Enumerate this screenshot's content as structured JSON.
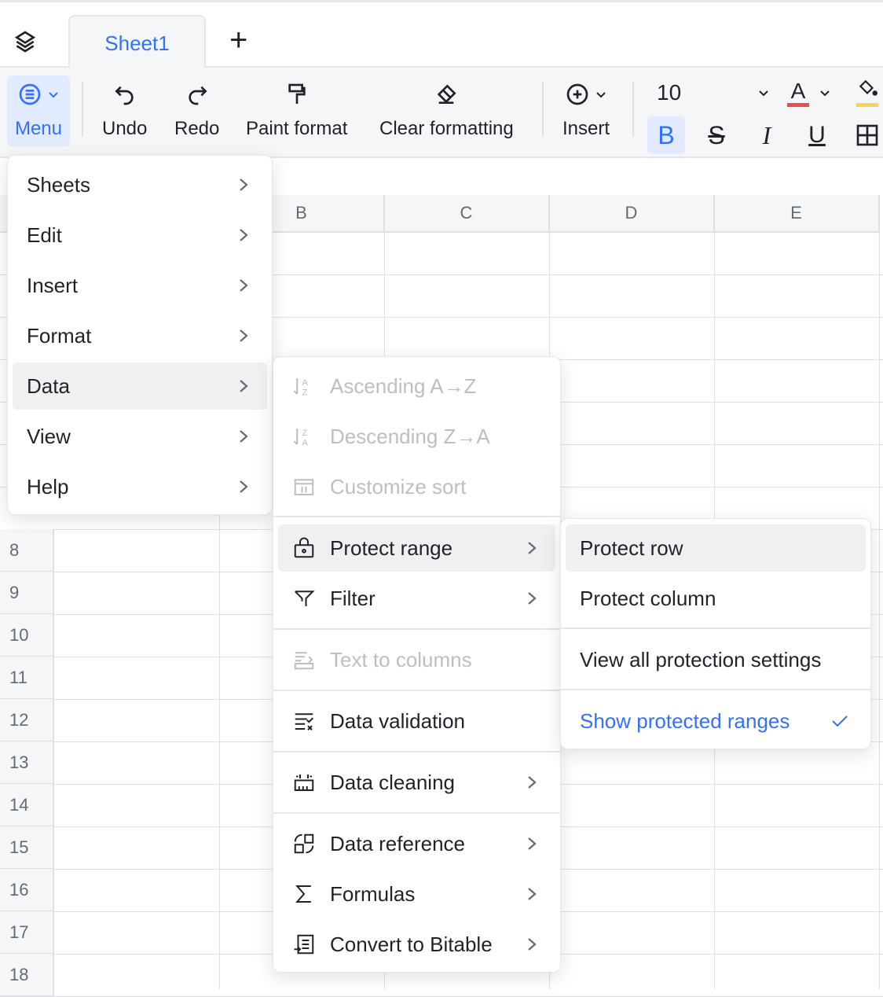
{
  "tabs": {
    "sheets": [
      "Sheet1"
    ],
    "active": "Sheet1",
    "add_label": "+"
  },
  "toolbar": {
    "menu": "Menu",
    "undo": "Undo",
    "redo": "Redo",
    "paint_format": "Paint format",
    "clear_formatting": "Clear formatting",
    "insert": "Insert",
    "font_size": "10",
    "bold": "B",
    "strike": "S",
    "italic": "I",
    "underline": "U",
    "text_color": "A",
    "accent": "#3370ff",
    "text_color_swatch": "#f54a45",
    "fill_color_swatch": "#fad355"
  },
  "columns": [
    "B",
    "C",
    "D",
    "E"
  ],
  "rows": [
    "8",
    "9",
    "10",
    "11",
    "12",
    "13",
    "14",
    "15",
    "16",
    "17",
    "18"
  ],
  "main_menu": {
    "items": [
      {
        "label": "Sheets"
      },
      {
        "label": "Edit"
      },
      {
        "label": "Insert"
      },
      {
        "label": "Format"
      },
      {
        "label": "Data",
        "highlighted": true
      },
      {
        "label": "View"
      },
      {
        "label": "Help"
      }
    ]
  },
  "data_menu": {
    "items": [
      {
        "label": "Ascending A→Z",
        "icon": "sort-ascending-icon",
        "disabled": true
      },
      {
        "label": "Descending Z→A",
        "icon": "sort-descending-icon",
        "disabled": true
      },
      {
        "label": "Customize sort",
        "icon": "customize-sort-icon",
        "disabled": true
      },
      {
        "label": "Protect range",
        "icon": "lock-icon",
        "submenu": true,
        "highlighted": true
      },
      {
        "label": "Filter",
        "icon": "filter-icon",
        "submenu": true
      },
      {
        "label": "Text to columns",
        "icon": "text-to-columns-icon",
        "disabled": true
      },
      {
        "label": "Data validation",
        "icon": "data-validation-icon"
      },
      {
        "label": "Data cleaning",
        "icon": "data-cleaning-icon",
        "submenu": true
      },
      {
        "label": "Data reference",
        "icon": "data-reference-icon",
        "submenu": true
      },
      {
        "label": "Formulas",
        "icon": "sigma-icon",
        "submenu": true
      },
      {
        "label": "Convert to Bitable",
        "icon": "bitable-icon",
        "submenu": true
      }
    ]
  },
  "protect_menu": {
    "items": [
      {
        "label": "Protect row",
        "highlighted": true
      },
      {
        "label": "Protect column"
      },
      {
        "label": "View all protection settings"
      },
      {
        "label": "Show protected ranges",
        "checked": true
      }
    ]
  }
}
